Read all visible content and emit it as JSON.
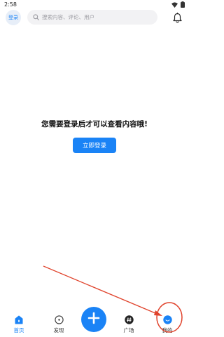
{
  "status_bar": {
    "time": "2:58"
  },
  "top_bar": {
    "login_label": "登录",
    "search_placeholder": "搜索内容、评论、用户"
  },
  "main": {
    "message": "您需要登录后才可以查看内容哦!",
    "login_button_label": "立即登录"
  },
  "bottom_nav": {
    "items": [
      {
        "label": "首页",
        "icon": "home-icon",
        "active": true
      },
      {
        "label": "发现",
        "icon": "discover-icon",
        "active": false
      },
      {
        "label": "",
        "icon": "plus-icon",
        "active": false
      },
      {
        "label": "广场",
        "icon": "square-hash-icon",
        "active": false
      },
      {
        "label": "我的",
        "icon": "profile-smile-icon",
        "active": false
      }
    ]
  },
  "colors": {
    "accent": "#1a83f6",
    "annotation": "#e0432c",
    "search_bg": "#f2f2f4",
    "avatar_bg": "#e7eef8"
  }
}
